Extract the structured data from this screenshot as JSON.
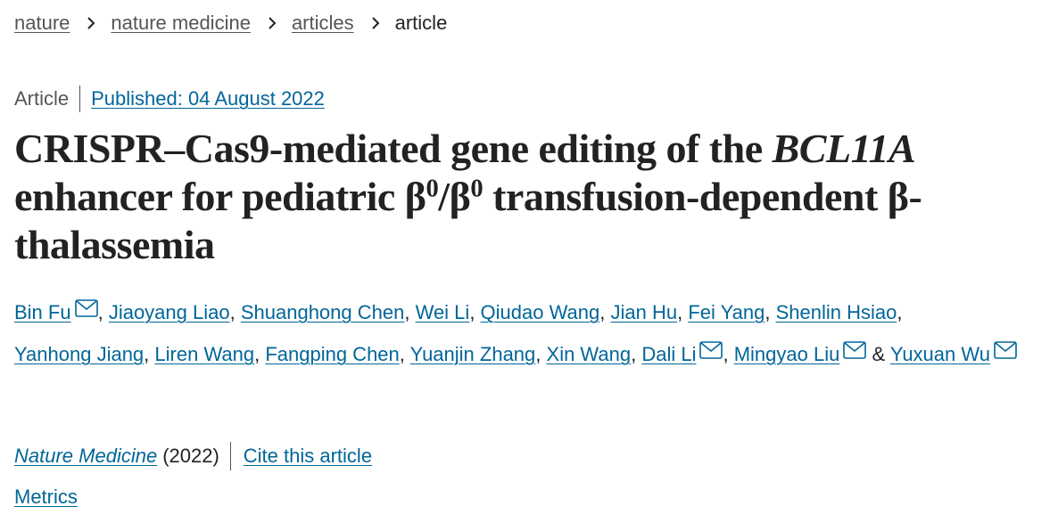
{
  "breadcrumb": {
    "items": [
      "nature",
      "nature medicine",
      "articles"
    ],
    "current": "article"
  },
  "article_meta": {
    "type": "Article",
    "published": "Published: 04 August 2022"
  },
  "title": {
    "part1": "CRISPR–Cas9-mediated gene editing of the ",
    "gene": "BCL11A",
    "part2": " enhancer for pediatric β",
    "sup1": "0",
    "slash": "/β",
    "sup2": "0",
    "part3": " transfusion-dependent β-thalassemia"
  },
  "authors": [
    {
      "name": "Bin Fu",
      "email": true
    },
    {
      "name": "Jiaoyang Liao",
      "email": false
    },
    {
      "name": "Shuanghong Chen",
      "email": false
    },
    {
      "name": "Wei Li",
      "email": false
    },
    {
      "name": "Qiudao Wang",
      "email": false
    },
    {
      "name": "Jian Hu",
      "email": false
    },
    {
      "name": "Fei Yang",
      "email": false
    },
    {
      "name": "Shenlin Hsiao",
      "email": false
    },
    {
      "name": "Yanhong Jiang",
      "email": false
    },
    {
      "name": "Liren Wang",
      "email": false
    },
    {
      "name": "Fangping Chen",
      "email": false
    },
    {
      "name": "Yuanjin Zhang",
      "email": false
    },
    {
      "name": "Xin Wang",
      "email": false
    },
    {
      "name": "Dali Li",
      "email": true
    },
    {
      "name": "Mingyao Liu",
      "email": true
    },
    {
      "name": "Yuxuan Wu",
      "email": true
    }
  ],
  "journal": {
    "name": "Nature Medicine",
    "year": "(2022)",
    "cite_label": "Cite this article"
  },
  "metrics_label": "Metrics"
}
